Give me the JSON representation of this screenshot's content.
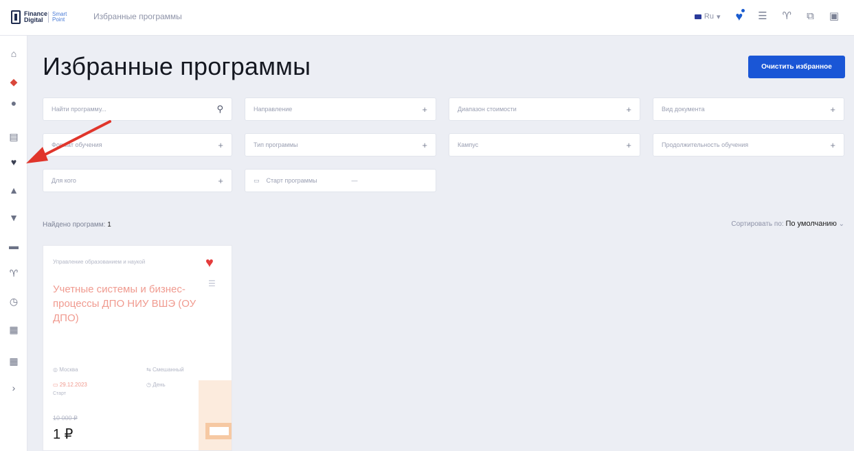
{
  "header": {
    "logo_text": "Finance Digital",
    "logo_sub": "Smart Point",
    "breadcrumb": "Избранные программы",
    "lang": "Ru",
    "icons": [
      "favorites-icon",
      "list-icon",
      "cup-icon",
      "compare-icon",
      "user-icon",
      "exit-icon"
    ]
  },
  "sidebar": {
    "items": [
      "home-icon",
      "rocket-icon",
      "globe-icon",
      "calculator-icon",
      "heart-icon",
      "thumbs-up-icon",
      "graduation-icon",
      "folder-icon",
      "cup-icon",
      "clock-icon",
      "briefcase-icon",
      "briefcase-icon",
      "chevron-right-icon"
    ]
  },
  "page": {
    "title": "Избранные программы",
    "clear_button": "Очистить избранное"
  },
  "filters": {
    "search_placeholder": "Найти программу...",
    "direction": "Направление",
    "price_range": "Диапазон стоимости",
    "doc_type": "Вид документа",
    "format": "Формат обучения",
    "program_type": "Тип программы",
    "campus": "Кампус",
    "duration": "Продолжительность обучения",
    "for_whom": "Для кого",
    "start_date": "Старт программы",
    "date_sep": "—"
  },
  "results": {
    "found_label": "Найдено программ:",
    "found_count": "1",
    "sort_label": "Сортировать по:",
    "sort_value": "По умолчанию"
  },
  "card": {
    "category": "Управление образованием и наукой",
    "title": "Учетные системы и бизнес-процессы ДПО НИУ ВШЭ (ОУ ДПО)",
    "city": "Москва",
    "mode": "Смешанный",
    "date": "29.12.2023",
    "time_of_day": "День",
    "date_note": "Старт",
    "old_price": "10 000 ₽",
    "price": "1 ₽"
  },
  "colors": {
    "accent": "#1a56d6",
    "heart": "#e43c3c",
    "title_pink": "#f09a8f",
    "annotation_arrow": "#e0352b"
  }
}
